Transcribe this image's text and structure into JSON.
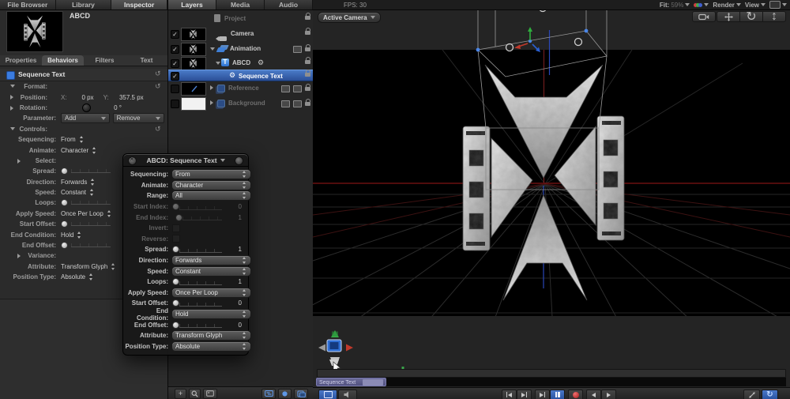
{
  "icons": {
    "reset": "↺",
    "check": "✓",
    "gear": "⚙",
    "plus": "+",
    "letter_t": "T",
    "orbit": "↻",
    "dolly": "↕",
    "loop": "↻"
  },
  "left_panel": {
    "tabs": [
      "File Browser",
      "Library",
      "Inspector"
    ],
    "preview_title": "ABCD",
    "subtabs": [
      "Properties",
      "Behaviors",
      "Filters",
      "Text"
    ],
    "header_title": "Sequence Text",
    "rows": [
      {
        "label": "Format:",
        "type": "group"
      },
      {
        "label": "Position:",
        "type": "xy",
        "x_label": "X:",
        "x_value": "0 px",
        "y_label": "Y:",
        "y_value": "357.5 px"
      },
      {
        "label": "Rotation:",
        "type": "dial",
        "value": "0 °"
      },
      {
        "label": "Parameter:",
        "type": "buttons",
        "add": "Add",
        "remove": "Remove"
      },
      {
        "label": "Controls:",
        "type": "group"
      },
      {
        "label": "Sequencing:",
        "type": "popup",
        "value": "From"
      },
      {
        "label": "Animate:",
        "type": "popup",
        "value": "Character"
      },
      {
        "label": "Select:",
        "type": "disclosure"
      },
      {
        "label": "Spread:",
        "type": "slider"
      },
      {
        "label": "Direction:",
        "type": "popup",
        "value": "Forwards"
      },
      {
        "label": "Speed:",
        "type": "popup",
        "value": "Constant"
      },
      {
        "label": "Loops:",
        "type": "slider"
      },
      {
        "label": "Apply Speed:",
        "type": "popup",
        "value": "Once Per Loop"
      },
      {
        "label": "Start Offset:",
        "type": "slider"
      },
      {
        "label": "End Condition:",
        "type": "popup",
        "value": "Hold"
      },
      {
        "label": "End Offset:",
        "type": "slider"
      },
      {
        "label": "Variance:",
        "type": "disclosure"
      },
      {
        "label": "Attribute:",
        "type": "popup",
        "value": "Transform Glyph"
      },
      {
        "label": "Position Type:",
        "type": "popup",
        "value": "Absolute"
      }
    ]
  },
  "layers_panel": {
    "tabs": [
      "Layers",
      "Media",
      "Audio"
    ],
    "rows": [
      {
        "name": "Project"
      },
      {
        "name": "Camera"
      },
      {
        "name": "Animation"
      },
      {
        "name": "ABCD"
      },
      {
        "name": "Sequence Text"
      },
      {
        "name": "Reference"
      },
      {
        "name": "Background"
      }
    ]
  },
  "hud": {
    "title": "ABCD: Sequence Text",
    "rows": [
      {
        "label": "Sequencing:",
        "type": "popup",
        "value": "From"
      },
      {
        "label": "Animate:",
        "type": "popup",
        "value": "Character"
      },
      {
        "label": "Range:",
        "type": "popup",
        "value": "All"
      },
      {
        "label": "Start Index:",
        "type": "slider",
        "value": "0",
        "dimmed": true
      },
      {
        "label": "End Index:",
        "type": "slider",
        "value": "1",
        "dimmed": true
      },
      {
        "label": "Invert:",
        "type": "checkbox",
        "dimmed": true
      },
      {
        "label": "Reverse:",
        "type": "checkbox",
        "dimmed": true
      },
      {
        "label": "Spread:",
        "type": "slider",
        "value": "1"
      },
      {
        "label": "Direction:",
        "type": "popup",
        "value": "Forwards"
      },
      {
        "label": "Speed:",
        "type": "popup",
        "value": "Constant"
      },
      {
        "label": "Loops:",
        "type": "slider",
        "value": "1"
      },
      {
        "label": "Apply Speed:",
        "type": "popup",
        "value": "Once Per Loop"
      },
      {
        "label": "Start Offset:",
        "type": "slider",
        "value": "0"
      },
      {
        "label": "End Condition:",
        "type": "popup",
        "value": "Hold"
      },
      {
        "label": "End Offset:",
        "type": "slider",
        "value": "0"
      },
      {
        "label": "Attribute:",
        "type": "popup",
        "value": "Transform Glyph"
      },
      {
        "label": "Position Type:",
        "type": "popup",
        "value": "Absolute"
      }
    ]
  },
  "canvas": {
    "fps": "FPS: 30",
    "camera_menu": "Active Camera",
    "zoom_label": "Fit:",
    "zoom_value": "59%",
    "render_menu": "Render",
    "view_menu": "View",
    "timeline_clip": "Sequence Text"
  },
  "colors": {
    "accent_blue": "#3b7ce0",
    "selection_blue": "#3a6fc0",
    "horizon_red": "#801313",
    "clip_purple": "#5c5c8e"
  }
}
